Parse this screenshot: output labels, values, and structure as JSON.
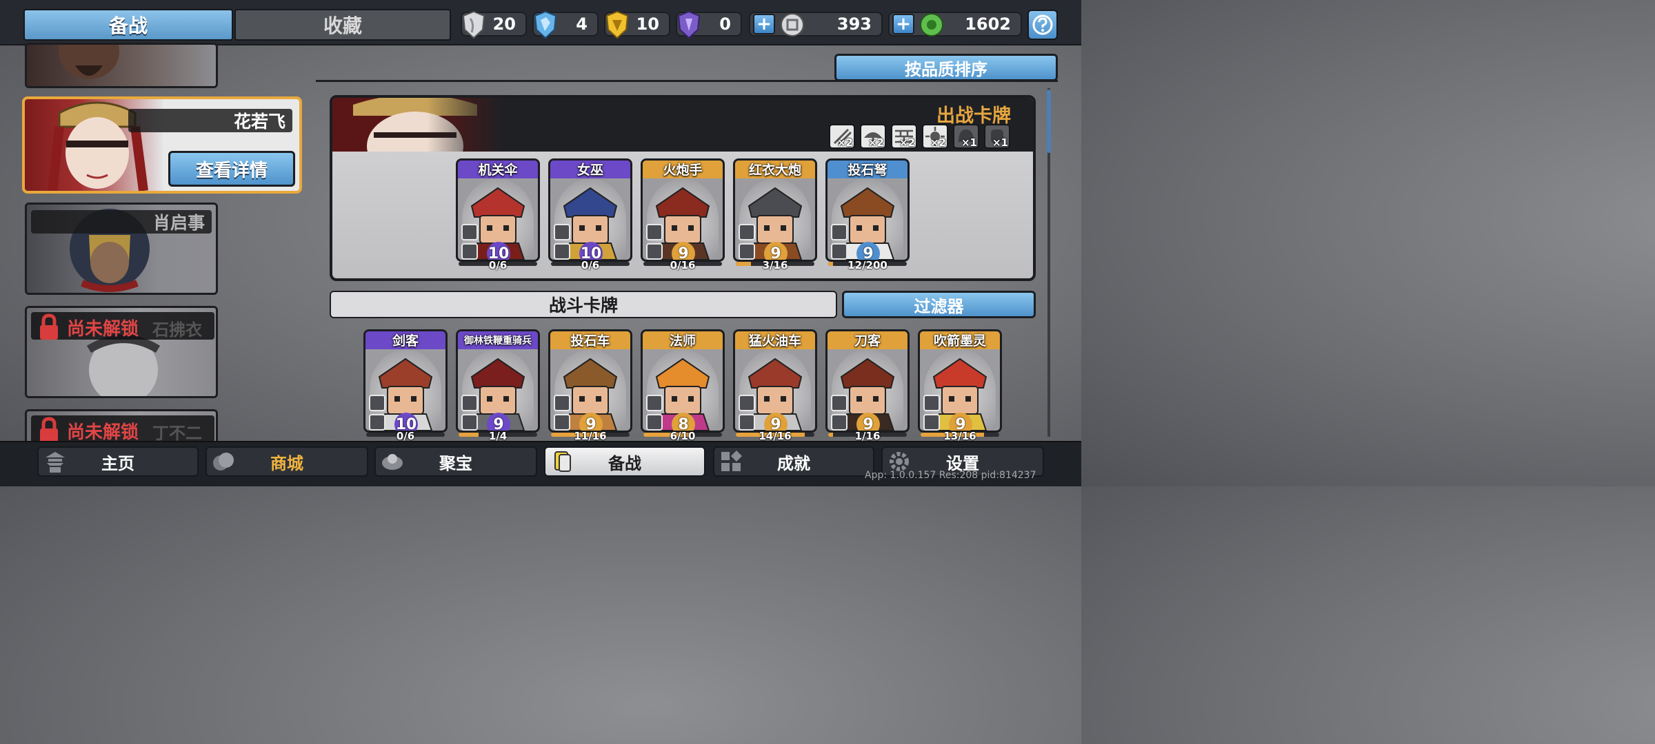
{
  "top_tabs": {
    "active": "备战",
    "other": "收藏"
  },
  "resources": [
    {
      "icon": "silver-shield-icon",
      "value": "20"
    },
    {
      "icon": "blue-crystal-icon",
      "value": "4"
    },
    {
      "icon": "gold-shield-icon",
      "value": "10"
    },
    {
      "icon": "purple-crystal-icon",
      "value": "0"
    },
    {
      "icon": "silver-coin-icon",
      "value": "393"
    },
    {
      "icon": "jade-coin-icon",
      "value": "1602"
    }
  ],
  "heroes": {
    "selected": {
      "name": "花若飞",
      "detail_button": "查看详情"
    },
    "second": {
      "name": "肖启事"
    },
    "locked": [
      {
        "lock_label": "尚未解锁",
        "name": "石拂衣"
      },
      {
        "lock_label": "尚未解锁",
        "name": "丁不二"
      }
    ]
  },
  "sort_button": "按品质排序",
  "deck": {
    "title": "出战卡牌",
    "buffs": [
      {
        "icon": "arrows-icon",
        "mult": "×2"
      },
      {
        "icon": "umbrella-icon",
        "mult": "×2"
      },
      {
        "icon": "wall-icon",
        "mult": "×2"
      },
      {
        "icon": "burst-icon",
        "mult": "×2"
      },
      {
        "icon": "helmet-icon",
        "mult": "×1"
      },
      {
        "icon": "mask-icon",
        "mult": "×1"
      }
    ],
    "cards": [
      {
        "name": "机关伞",
        "level": "10",
        "progress": "0/6",
        "rarity_color": "#6c49c7",
        "fill": 0
      },
      {
        "name": "女巫",
        "level": "10",
        "progress": "0/6",
        "rarity_color": "#6c49c7",
        "fill": 0
      },
      {
        "name": "火炮手",
        "level": "9",
        "progress": "0/16",
        "rarity_color": "#e0a13a",
        "fill": 0
      },
      {
        "name": "红衣大炮",
        "level": "9",
        "progress": "3/16",
        "rarity_color": "#e0a13a",
        "fill": 0.19
      },
      {
        "name": "投石弩",
        "level": "9",
        "progress": "12/200",
        "rarity_color": "#4f8fd0",
        "fill": 0.06
      }
    ]
  },
  "battle_cards": {
    "title": "战斗卡牌",
    "filter_button": "过滤器",
    "cards": [
      {
        "name": "剑客",
        "level": "10",
        "progress": "0/6",
        "rarity_color": "#6c49c7",
        "fill": 0
      },
      {
        "name": "御林铁鞭重骑兵",
        "level": "9",
        "progress": "1/4",
        "rarity_color": "#6c49c7",
        "fill": 0.25
      },
      {
        "name": "投石车",
        "level": "9",
        "progress": "11/16",
        "rarity_color": "#e0a13a",
        "fill": 0.69
      },
      {
        "name": "法师",
        "level": "8",
        "progress": "6/10",
        "rarity_color": "#e0a13a",
        "fill": 0.6
      },
      {
        "name": "猛火油车",
        "level": "9",
        "progress": "14/16",
        "rarity_color": "#e0a13a",
        "fill": 0.88
      },
      {
        "name": "刀客",
        "level": "9",
        "progress": "1/16",
        "rarity_color": "#e0a13a",
        "fill": 0.06
      },
      {
        "name": "吹箭墨灵",
        "level": "9",
        "progress": "13/16",
        "rarity_color": "#e0a13a",
        "fill": 0.81
      }
    ]
  },
  "bottom_nav": [
    {
      "label": "主页",
      "icon": "pagoda-icon"
    },
    {
      "label": "商城",
      "icon": "coins-icon"
    },
    {
      "label": "聚宝",
      "icon": "treasure-icon"
    },
    {
      "label": "备战",
      "icon": "card-icon"
    },
    {
      "label": "成就",
      "icon": "blocks-icon"
    },
    {
      "label": "设置",
      "icon": "gear-icon"
    }
  ],
  "version_text": "App: 1.0.0.157 Res:208 pid:814237"
}
